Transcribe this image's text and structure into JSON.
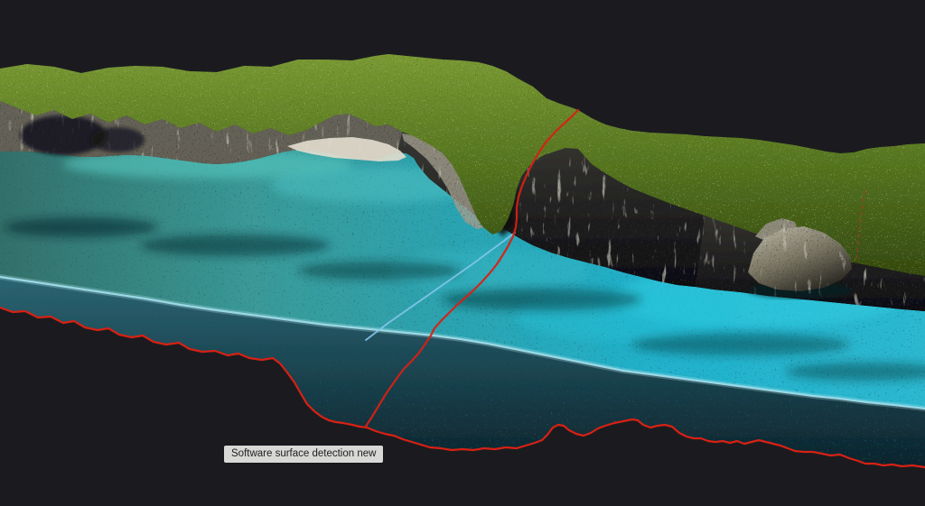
{
  "viewer": {
    "background_color": "#1b1b1f",
    "tooltip": {
      "label": "Software surface detection new",
      "background": "#d8d8d6",
      "text_color": "#1d1d1d"
    },
    "annotations": {
      "surface_boundary": {
        "name": "surface-detection-boundary",
        "color": "#d72114"
      },
      "cross_section": {
        "name": "cross-section-polyline",
        "color": "#d72114"
      },
      "water_edge": {
        "name": "water-surface-edge-line",
        "color": "#9edce9"
      },
      "profile_line": {
        "name": "diagonal-profile-line",
        "color": "#84c7ec"
      },
      "cliff_dashes": {
        "name": "cliff-dashed-line",
        "color": "#b8302a"
      }
    },
    "scene_palette": {
      "vegetation_green": "#5d7d26",
      "cliff_rock_gray": "#8a8678",
      "sand_beach": "#e3decf",
      "lagoon_turquoise": "#23b2cc",
      "deep_water_teal": "#1c4753"
    }
  }
}
